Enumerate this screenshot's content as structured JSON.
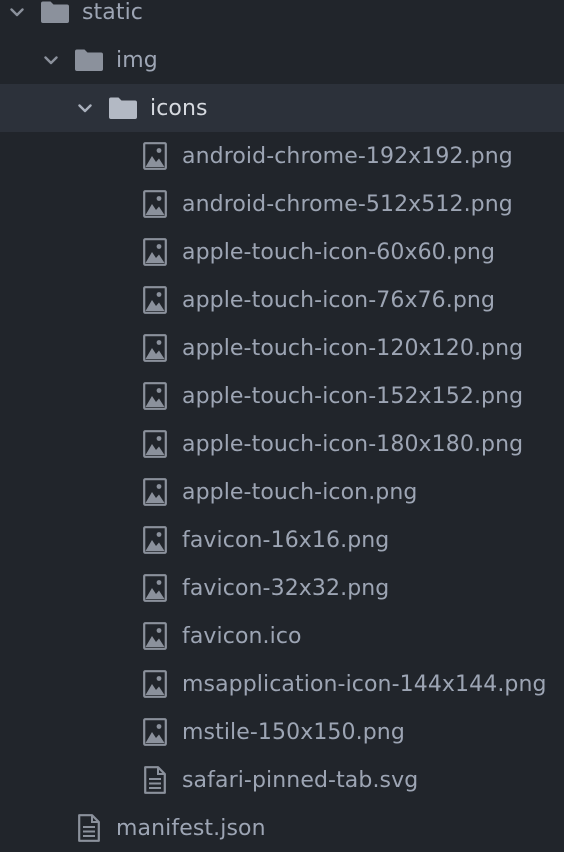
{
  "tree": {
    "folders": {
      "static": {
        "label": "static",
        "icon": "folder-icon",
        "expanded": true
      },
      "img": {
        "label": "img",
        "icon": "folder-icon",
        "expanded": true
      },
      "icons": {
        "label": "icons",
        "icon": "folder-icon",
        "expanded": true,
        "selected": true
      }
    },
    "files": [
      {
        "label": "android-chrome-192x192.png",
        "icon": "image-file-icon"
      },
      {
        "label": "android-chrome-512x512.png",
        "icon": "image-file-icon"
      },
      {
        "label": "apple-touch-icon-60x60.png",
        "icon": "image-file-icon"
      },
      {
        "label": "apple-touch-icon-76x76.png",
        "icon": "image-file-icon"
      },
      {
        "label": "apple-touch-icon-120x120.png",
        "icon": "image-file-icon"
      },
      {
        "label": "apple-touch-icon-152x152.png",
        "icon": "image-file-icon"
      },
      {
        "label": "apple-touch-icon-180x180.png",
        "icon": "image-file-icon"
      },
      {
        "label": "apple-touch-icon.png",
        "icon": "image-file-icon"
      },
      {
        "label": "favicon-16x16.png",
        "icon": "image-file-icon"
      },
      {
        "label": "favicon-32x32.png",
        "icon": "image-file-icon"
      },
      {
        "label": "favicon.ico",
        "icon": "image-file-icon"
      },
      {
        "label": "msapplication-icon-144x144.png",
        "icon": "image-file-icon"
      },
      {
        "label": "mstile-150x150.png",
        "icon": "image-file-icon"
      },
      {
        "label": "safari-pinned-tab.svg",
        "icon": "text-file-icon"
      }
    ],
    "manifest": {
      "label": "manifest.json",
      "icon": "text-file-icon"
    }
  },
  "colors": {
    "background": "#21252b",
    "selected_row": "#2c313a",
    "text": "#9da5b4",
    "selected_text": "#d7dae0",
    "icon": "#8b919c"
  }
}
